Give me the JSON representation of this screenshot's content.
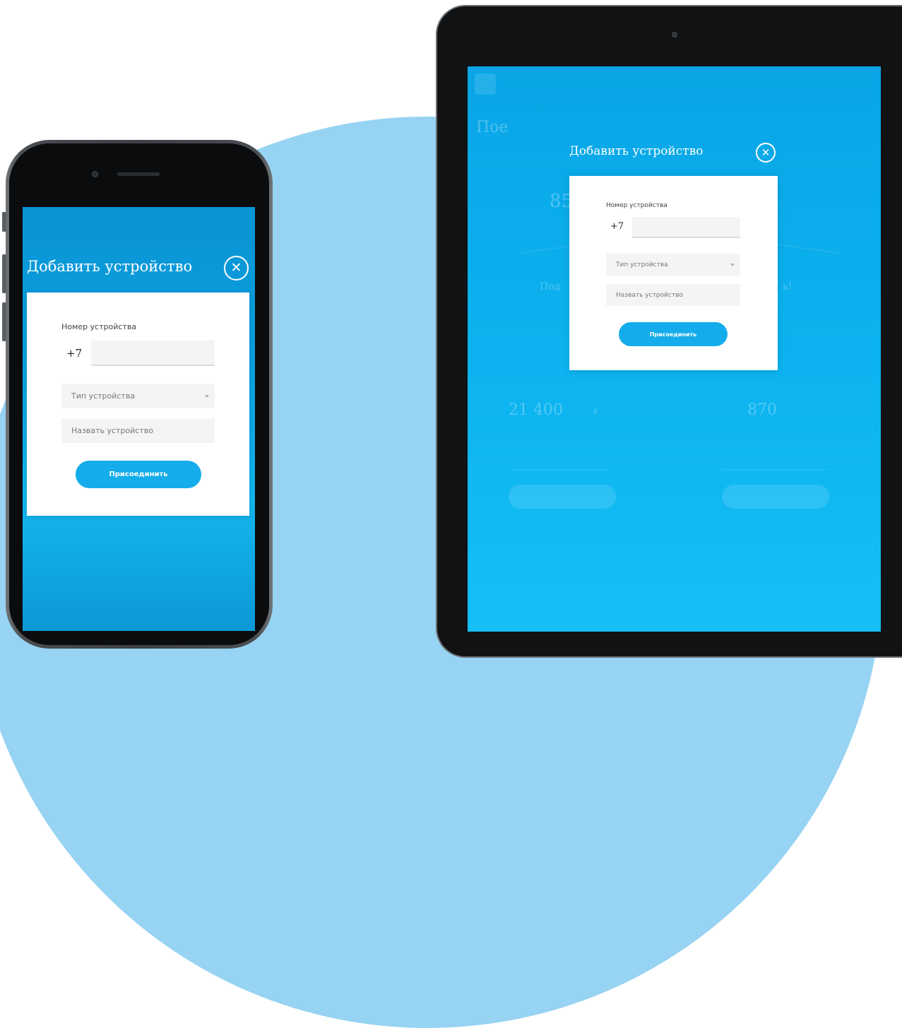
{
  "modal": {
    "title": "Добавить устройство",
    "close_icon": "close-icon",
    "phone_label": "Номер устройства",
    "phone_prefix": "+7",
    "phone_value": "",
    "device_type_placeholder": "Тип устройства",
    "device_name_placeholder": "Назвать устройство",
    "submit_label": "Присоединить"
  },
  "tablet_background": {
    "heading_fragment": "Пое",
    "stat_left_fragment": "85",
    "side_left_fragment": "Под",
    "side_right_fragment": "ь!",
    "amount": "21 400",
    "amount_unit": "₽",
    "points": "870"
  },
  "colors": {
    "accent": "#14acea",
    "blob": "#97d3f2",
    "screen_blue": "#0aa3e2"
  }
}
